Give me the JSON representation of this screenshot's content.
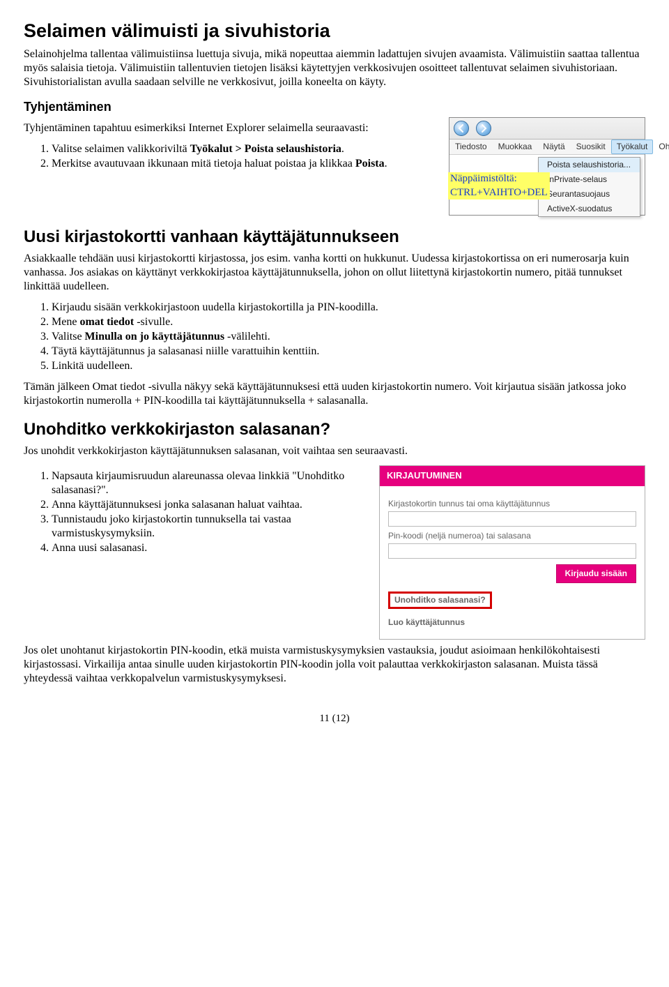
{
  "h1": "Selaimen välimuisti ja sivuhistoria",
  "p1": "Selainohjelma tallentaa välimuistiinsa luettuja sivuja, mikä nopeuttaa aiemmin ladattujen sivujen avaamista. Välimuistiin saattaa tallentua myös salaisia tietoja. Välimuistiin tallentuvien tietojen lisäksi käytettyjen verkkosivujen osoitteet tallentuvat selaimen sivuhistoriaan. Sivuhistorialistan avulla saadaan selville ne verkkosivut, joilla koneelta on käyty.",
  "h3_1": "Tyhjentäminen",
  "p2": "Tyhjentäminen tapahtuu esimerkiksi Internet Explorer selaimella seuraavasti:",
  "ol1": {
    "i1a": "Valitse selaimen valikkoriviltä ",
    "i1b": "Työkalut > Poista selaushistoria",
    "i1c": ".",
    "i2a": "Merkitse avautuvaan ikkunaan mitä tietoja haluat poistaa ja klikkaa ",
    "i2b": "Poista",
    "i2c": "."
  },
  "ie": {
    "menubar": [
      "Tiedosto",
      "Muokkaa",
      "Näytä",
      "Suosikit",
      "Työkalut",
      "Ohje"
    ],
    "dropdown": [
      "Poista selaushistoria...",
      "InPrivate-selaus",
      "Seurantasuojaus",
      "ActiveX-suodatus"
    ],
    "overlay1": "Näppäimistöltä:",
    "overlay2": "CTRL+VAIHTO+DEL"
  },
  "h2_1": "Uusi kirjastokortti vanhaan käyttäjätunnukseen",
  "p3": "Asiakkaalle tehdään uusi kirjastokortti kirjastossa, jos esim. vanha kortti on hukkunut. Uudessa kirjastokortissa on eri numerosarja kuin vanhassa. Jos asiakas on käyttänyt verkkokirjastoa käyttäjätunnuksella, johon on ollut liitettynä kirjastokortin numero, pitää tunnukset linkittää uudelleen.",
  "ol2": {
    "i1": "Kirjaudu sisään verkkokirjastoon uudella kirjastokortilla ja PIN-koodilla.",
    "i2a": "Mene ",
    "i2b": "omat tiedot",
    "i2c": " -sivulle.",
    "i3a": "Valitse ",
    "i3b": "Minulla on jo käyttäjätunnus",
    "i3c": " -välilehti.",
    "i4": "Täytä käyttäjätunnus ja salasanasi niille varattuihin kenttiin.",
    "i5": "Linkitä uudelleen."
  },
  "p4": "Tämän jälkeen Omat tiedot -sivulla näkyy sekä käyttäjätunnuksesi että uuden kirjastokortin numero. Voit kirjautua sisään jatkossa joko kirjastokortin numerolla + PIN-koodilla tai käyttäjätunnuksella + salasanalla.",
  "h2_2": "Unohditko verkkokirjaston salasanan?",
  "p5": "Jos unohdit verkkokirjaston käyttäjätunnuksen salasanan, voit vaihtaa sen seuraavasti.",
  "ol3": {
    "i1": "Napsauta kirjaumisruudun alareunassa olevaa linkkiä \"Unohditko salasanasi?\".",
    "i2": "Anna käyttäjätunnuksesi jonka salasanan haluat vaihtaa.",
    "i3": "Tunnistaudu joko kirjastokortin tunnuksella tai vastaa varmistuskysymyksiin.",
    "i4": "Anna uusi salasanasi."
  },
  "login": {
    "header": "KIRJAUTUMINEN",
    "label1": "Kirjastokortin tunnus tai oma käyttäjätunnus",
    "label2": "Pin-koodi (neljä numeroa) tai salasana",
    "button": "Kirjaudu sisään",
    "link1": "Unohditko salasanasi?",
    "link2": "Luo käyttäjätunnus"
  },
  "p6": "Jos olet unohtanut kirjastokortin PIN-koodin, etkä muista varmistuskysymyksien vastauksia, joudut asioimaan henkilökohtaisesti kirjastossasi. Virkailija antaa sinulle uuden kirjastokortin PIN-koodin jolla voit palauttaa verkkokirjaston salasanan. Muista tässä yhteydessä vaihtaa verkkopalvelun varmistuskysymyksesi.",
  "footer": "11 (12)"
}
